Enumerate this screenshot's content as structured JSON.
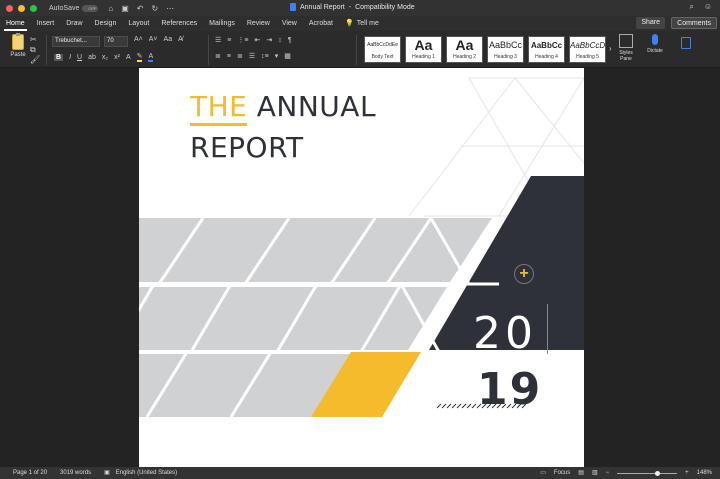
{
  "titlebar": {
    "autosave_label": "AutoSave",
    "autosave_state": "OFF",
    "document_title": "Annual Report",
    "mode": "Compatibility Mode",
    "separator": "-"
  },
  "tabs": [
    {
      "label": "Home",
      "active": true
    },
    {
      "label": "Insert"
    },
    {
      "label": "Draw"
    },
    {
      "label": "Design"
    },
    {
      "label": "Layout"
    },
    {
      "label": "References"
    },
    {
      "label": "Mailings"
    },
    {
      "label": "Review"
    },
    {
      "label": "View"
    },
    {
      "label": "Acrobat"
    }
  ],
  "tell_me": "Tell me",
  "share_label": "Share",
  "comments_label": "Comments",
  "ribbon": {
    "paste_label": "Paste",
    "font_name": "Trebuchet...",
    "font_size": "70",
    "styles": [
      {
        "sample": "AaBbCcDdEe",
        "name": "Body Text"
      },
      {
        "sample": "Aa",
        "name": "Heading 1"
      },
      {
        "sample": "Aa",
        "name": "Heading 2"
      },
      {
        "sample": "AaBbCc",
        "name": "Heading 3"
      },
      {
        "sample": "AaBbCc",
        "name": "Heading 4"
      },
      {
        "sample": "AaBbCcD",
        "name": "Heading 5"
      }
    ],
    "styles_pane_label": "Styles Pane",
    "dictate_label": "Dictate"
  },
  "document": {
    "title_highlight": "THE",
    "title_rest": "ANNUAL",
    "title_line2": "REPORT",
    "year_top": "20",
    "year_bottom": "19",
    "accent_color": "#f4bb2c",
    "dark_color": "#2e3139",
    "gray_color": "#d0d1d3"
  },
  "status": {
    "page": "Page 1 of 20",
    "words": "3019 words",
    "language": "English (United States)",
    "focus": "Focus",
    "zoom": "148%"
  }
}
